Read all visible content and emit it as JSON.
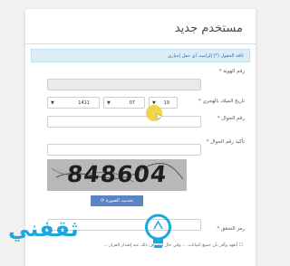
{
  "form": {
    "title": "مستخدم جديد",
    "info_message": "كافة الحقول (*) إلزامية، أي حقل إجباري",
    "id_label": "رقم الهوية *",
    "birthdate_label": "تاريخ الميلاد بالهجري *",
    "birthdate": {
      "day": "19",
      "month": "07",
      "year": "1411"
    },
    "mobile_label": "رقم الجوال *",
    "confirm_mobile_label": "تأكيد رقم الجوال *",
    "captcha_code": "848604",
    "refresh_button": "تحديث الصورة",
    "verify_label": "رمز التحقق *",
    "terms_text": "☐ أتعهد وأقر بأن جميع البيانات ... وفي حال اكتشاف ذلك عند إصدار القرار ..."
  },
  "watermark": {
    "logo_text": "ثقفني"
  },
  "colors": {
    "info_bg": "#dcedf8",
    "button": "#5b84c4",
    "cursor": "#f0d238",
    "logo": "#1da8dd"
  }
}
